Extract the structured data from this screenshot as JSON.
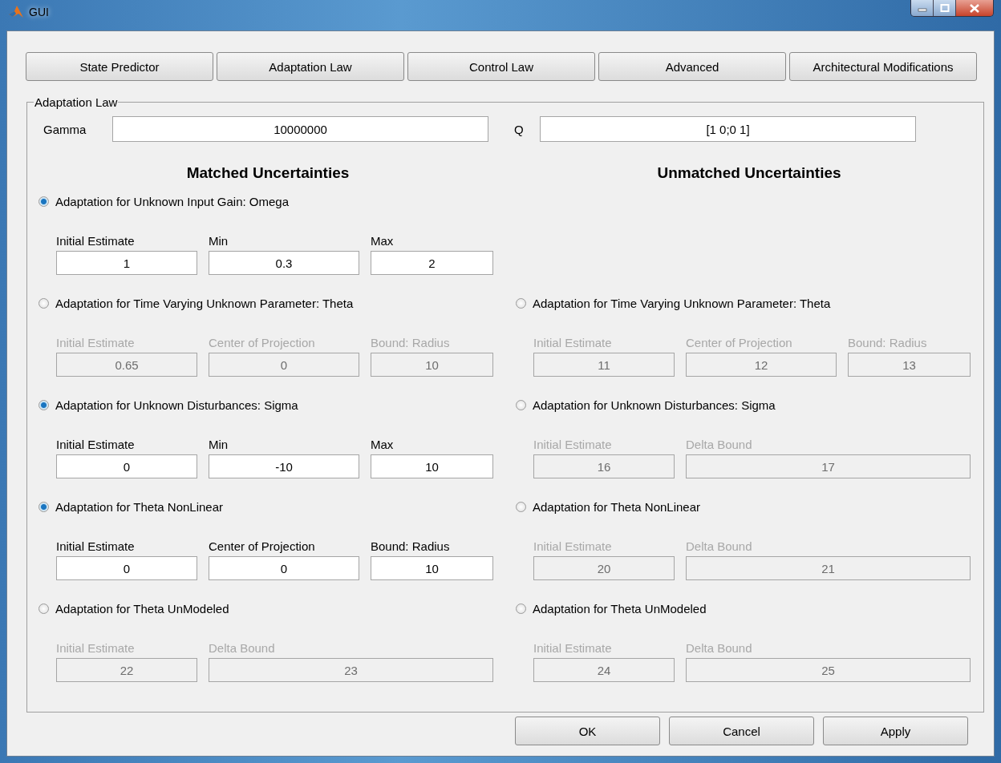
{
  "window": {
    "title": "GUI"
  },
  "tabs": [
    {
      "label": "State Predictor"
    },
    {
      "label": "Adaptation Law"
    },
    {
      "label": "Control Law"
    },
    {
      "label": "Advanced"
    },
    {
      "label": "Architectural Modifications"
    }
  ],
  "panel": {
    "title": "Adaptation Law",
    "gamma": {
      "label": "Gamma",
      "value": "10000000"
    },
    "q": {
      "label": "Q",
      "value": "[1 0;0 1]"
    },
    "headings": [
      "Matched Uncertainties",
      "Unmatched Uncertainties"
    ],
    "rows": [
      {
        "matched": {
          "label": "Adaptation for Unknown Input Gain: Omega",
          "selected": true,
          "disabled": false,
          "fields": [
            {
              "label": "Initial Estimate",
              "value": "1"
            },
            {
              "label": "Min",
              "value": "0.3"
            },
            {
              "label": "Max",
              "value": "2"
            }
          ]
        }
      },
      {
        "matched": {
          "label": "Adaptation for Time Varying Unknown Parameter: Theta",
          "selected": false,
          "disabled": true,
          "fields": [
            {
              "label": "Initial Estimate",
              "value": "0.65"
            },
            {
              "label": "Center of Projection",
              "value": "0"
            },
            {
              "label": "Bound: Radius",
              "value": "10"
            }
          ]
        },
        "unmatched": {
          "label": "Adaptation for Time Varying Unknown Parameter: Theta",
          "selected": false,
          "disabled": true,
          "fields": [
            {
              "label": "Initial Estimate",
              "value": "11"
            },
            {
              "label": "Center of Projection",
              "value": "12"
            },
            {
              "label": "Bound: Radius",
              "value": "13"
            }
          ]
        }
      },
      {
        "matched": {
          "label": "Adaptation for Unknown Disturbances: Sigma",
          "selected": true,
          "disabled": false,
          "fields": [
            {
              "label": "Initial Estimate",
              "value": "0"
            },
            {
              "label": "Min",
              "value": "-10"
            },
            {
              "label": "Max",
              "value": "10"
            }
          ]
        },
        "unmatched": {
          "label": "Adaptation for Unknown Disturbances: Sigma",
          "selected": false,
          "disabled": true,
          "fields": [
            {
              "label": "Initial Estimate",
              "value": "16"
            },
            {
              "label": "Delta Bound",
              "value": "17"
            }
          ]
        }
      },
      {
        "matched": {
          "label": "Adaptation for Theta NonLinear",
          "selected": true,
          "disabled": false,
          "fields": [
            {
              "label": "Initial Estimate",
              "value": "0"
            },
            {
              "label": "Center of Projection",
              "value": "0"
            },
            {
              "label": "Bound: Radius",
              "value": "10"
            }
          ]
        },
        "unmatched": {
          "label": "Adaptation for Theta NonLinear",
          "selected": false,
          "disabled": true,
          "fields": [
            {
              "label": "Initial Estimate",
              "value": "20"
            },
            {
              "label": "Delta Bound",
              "value": "21"
            }
          ]
        }
      },
      {
        "matched": {
          "label": "Adaptation for Theta UnModeled",
          "selected": false,
          "disabled": true,
          "fields": [
            {
              "label": "Initial Estimate",
              "value": "22"
            },
            {
              "label": "Delta Bound",
              "value": "23"
            }
          ]
        },
        "unmatched": {
          "label": "Adaptation for Theta UnModeled",
          "selected": false,
          "disabled": true,
          "fields": [
            {
              "label": "Initial Estimate",
              "value": "24"
            },
            {
              "label": "Delta Bound",
              "value": "25"
            }
          ]
        }
      }
    ]
  },
  "buttons": [
    "OK",
    "Cancel",
    "Apply"
  ]
}
